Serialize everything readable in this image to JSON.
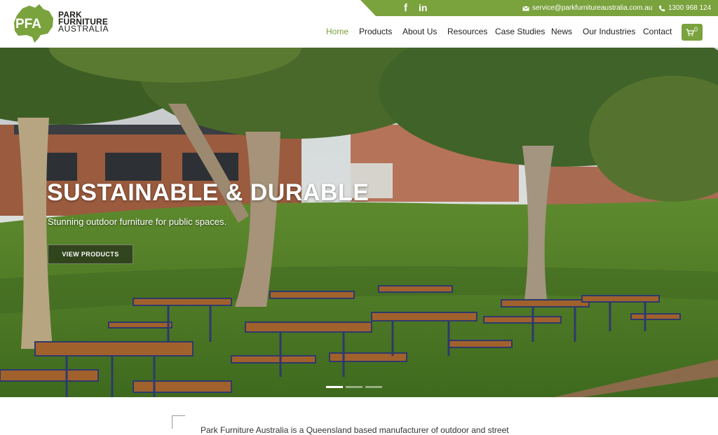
{
  "brand": {
    "monogram": "PFA",
    "line1": "PARK",
    "line2": "FURNITURE",
    "line3": "AUSTRALIA",
    "color": "#7aa23d"
  },
  "topbar": {
    "social": [
      {
        "icon": "facebook-icon",
        "glyph": "f"
      },
      {
        "icon": "linkedin-icon",
        "glyph": "in"
      }
    ],
    "email": "service@parkfurnitureaustralia.com.au",
    "phone": "1300 968 124"
  },
  "nav": {
    "items": [
      {
        "label": "Home",
        "active": true
      },
      {
        "label": "Products"
      },
      {
        "label": "About Us"
      },
      {
        "label": "Resources"
      },
      {
        "label": "Case Studies"
      },
      {
        "label": "News"
      },
      {
        "label": "Our Industries"
      },
      {
        "label": "Contact"
      }
    ],
    "cart_count": "0",
    "cart_icon": "cart-icon"
  },
  "hero": {
    "title": "SUSTAINABLE & DURABLE",
    "subtitle": "Stunning outdoor furniture for public spaces.",
    "button_label": "VIEW PRODUCTS",
    "slides": 3,
    "active_slide": 1
  },
  "intro": {
    "text": "Park Furniture Australia is a Queensland based manufacturer of outdoor and street"
  }
}
